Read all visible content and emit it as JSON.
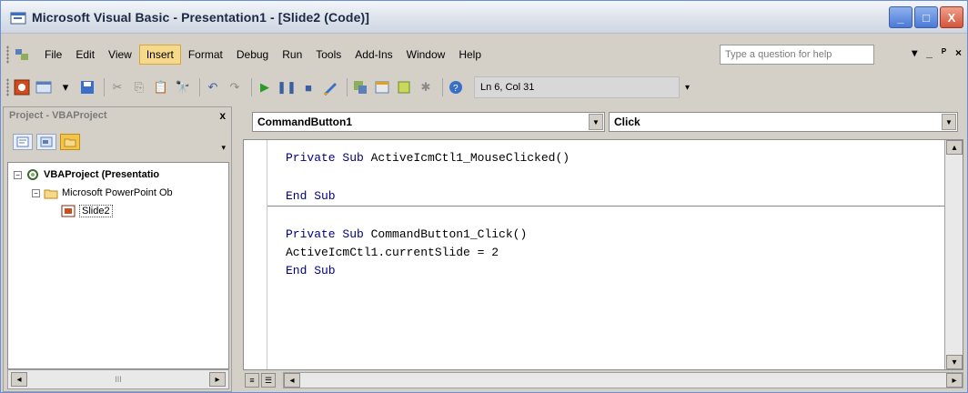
{
  "window": {
    "title": "Microsoft Visual Basic - Presentation1 - [Slide2 (Code)]",
    "controls": [
      "_",
      "□",
      "X"
    ]
  },
  "menubar": {
    "items": [
      "File",
      "Edit",
      "View",
      "Insert",
      "Format",
      "Debug",
      "Run",
      "Tools",
      "Add-Ins",
      "Window",
      "Help"
    ],
    "active": "Insert",
    "help_placeholder": "Type a question for help",
    "mdi_controls": [
      "▾",
      "_",
      "ᴾ",
      "×"
    ]
  },
  "toolbar": {
    "status": "Ln 6, Col 31"
  },
  "project": {
    "title": "Project - VBAProject",
    "close": "x",
    "tree": [
      {
        "label": "VBAProject (Presentatio",
        "expander": "−"
      },
      {
        "label": "Microsoft PowerPoint Ob",
        "expander": "−"
      },
      {
        "label": "Slide2"
      }
    ],
    "scroll_thumb": "III"
  },
  "code": {
    "object_combo": "CommandButton1",
    "procedure_combo": "Click",
    "lines": [
      {
        "kw": "Private Sub ",
        "text": "ActiveIcmCtl1_MouseClicked()"
      },
      {
        "kw": "End Sub",
        "text": ""
      },
      {
        "kw": "Private Sub ",
        "text": "CommandButton1_Click()"
      },
      {
        "kw": "",
        "text": "ActiveIcmCtl1.currentSlide = 2"
      },
      {
        "kw": "End Sub",
        "text": ""
      }
    ]
  },
  "icons": {
    "app": "vba-app-icon",
    "accent": "#f7d98b",
    "title_close": "#d4543a"
  }
}
